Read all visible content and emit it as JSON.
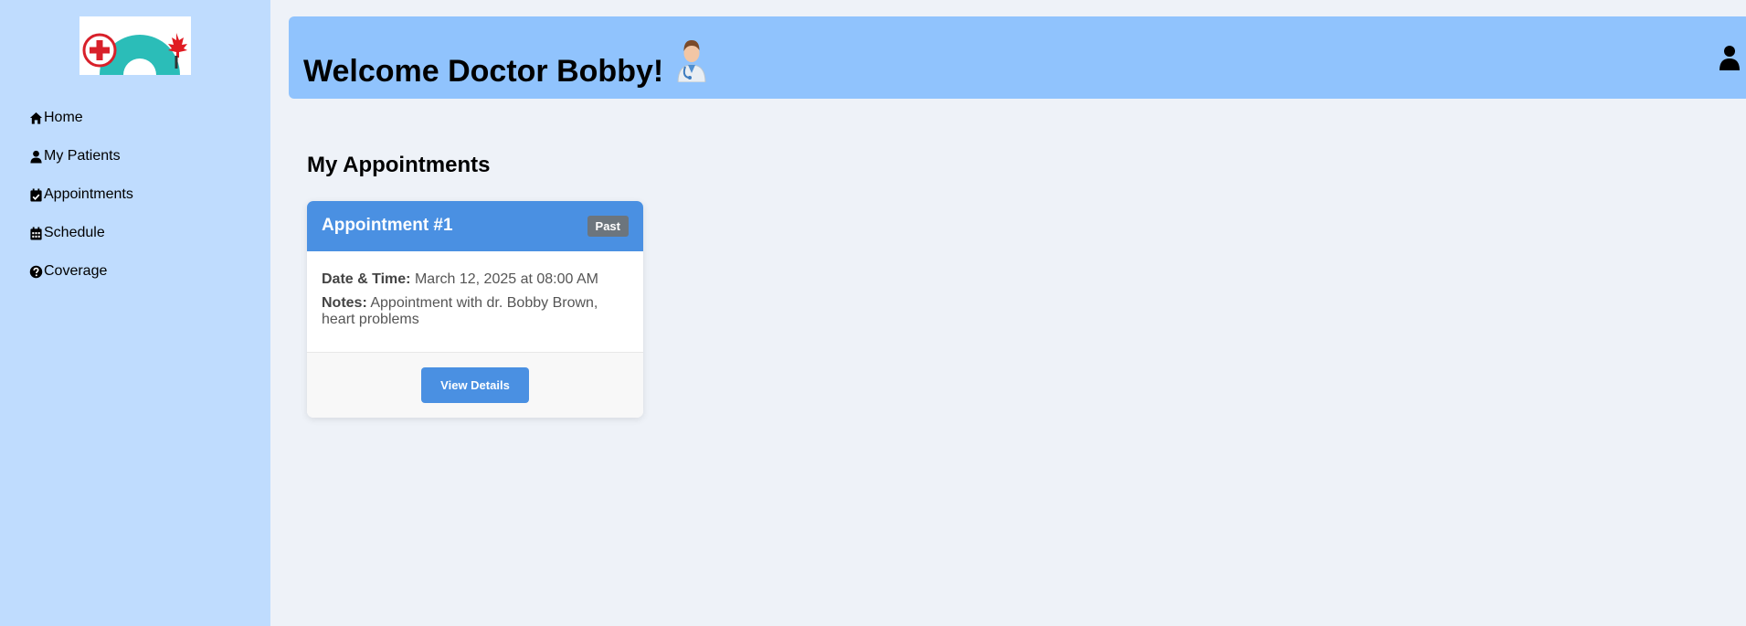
{
  "sidebar": {
    "logo_icon": "canada-health-logo",
    "items": [
      {
        "label": "Home",
        "icon": "home-icon"
      },
      {
        "label": "My Patients",
        "icon": "user-icon"
      },
      {
        "label": "Appointments",
        "icon": "calendar-check-icon"
      },
      {
        "label": "Schedule",
        "icon": "calendar-grid-icon"
      },
      {
        "label": "Coverage",
        "icon": "question-circle-icon"
      }
    ]
  },
  "header": {
    "title": "Welcome Doctor Bobby!",
    "avatar_icon": "doctor-icon",
    "profile_icon": "user-icon"
  },
  "main": {
    "section_title": "My Appointments",
    "appointments": [
      {
        "title": "Appointment #1",
        "status": "Past",
        "datetime_label": "Date & Time:",
        "datetime_value": "March 12, 2025 at 08:00 AM",
        "notes_label": "Notes:",
        "notes_value": "Appointment with dr. Bobby Brown, heart problems",
        "button_label": "View Details"
      }
    ]
  },
  "colors": {
    "sidebar_bg": "#bfdcfe",
    "header_bg": "#90c3fd",
    "card_header": "#4a90e2",
    "badge_past": "#6c757d",
    "page_bg": "#eef2f8"
  }
}
